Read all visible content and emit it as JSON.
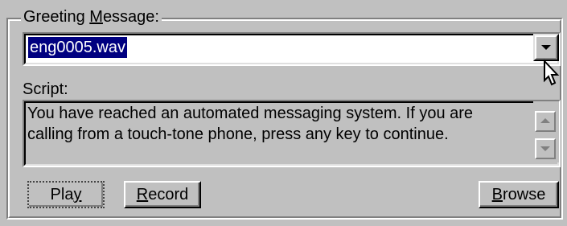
{
  "greeting_group": {
    "legend_pre": "Greeting ",
    "legend_mnemonic": "M",
    "legend_post": "essage:",
    "selected_file": "eng0005.wav"
  },
  "script": {
    "label": "Script:",
    "text": "You have reached an automated messaging system.  If you are\ncalling from a touch-tone phone, press any key to continue."
  },
  "buttons": {
    "play_pre": "Pla",
    "play_mnemonic": "y",
    "record_mnemonic": "R",
    "record_post": "ecord",
    "browse_mnemonic": "B",
    "browse_post": "rowse"
  },
  "icons": {
    "combo_dropdown": "chevron-down-icon",
    "cursor": "mouse-pointer-icon",
    "scroll_up": "scroll-up-icon",
    "scroll_down": "scroll-down-icon"
  },
  "colors": {
    "face": "#c0c0c0",
    "selection": "#000080"
  }
}
